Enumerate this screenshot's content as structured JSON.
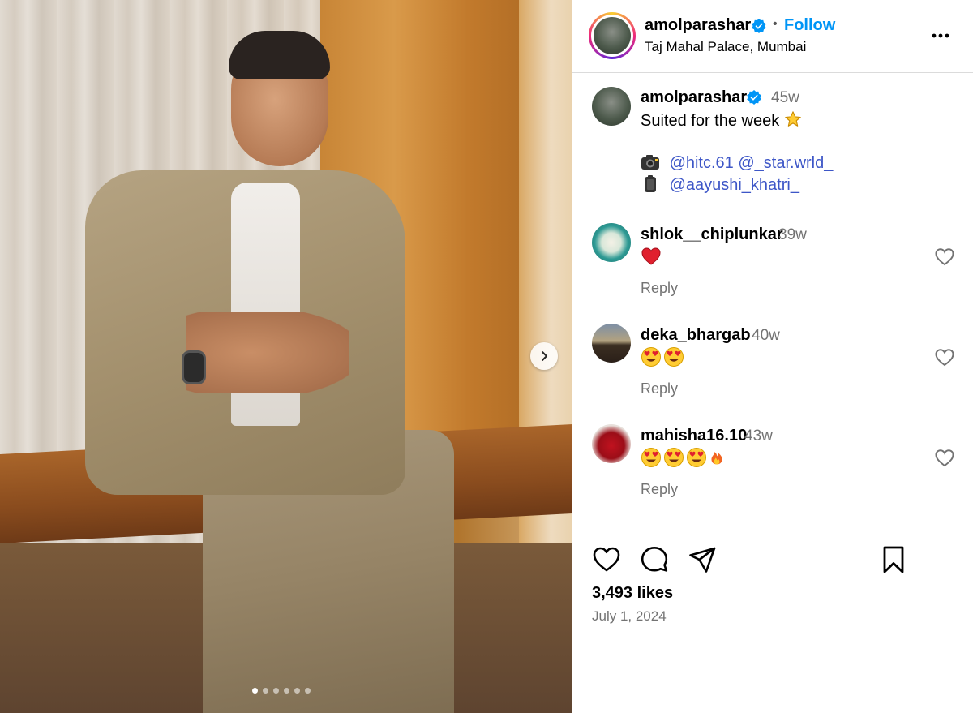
{
  "post": {
    "photo": {
      "carousel_dots": 6,
      "active_dot": 0
    },
    "header": {
      "username": "amolparashar",
      "separator": "•",
      "follow_label": "Follow",
      "location": "Taj Mahal Palace, Mumbai"
    },
    "caption": {
      "username": "amolparashar",
      "time": "45w",
      "text": "Suited for the week",
      "line1_mention1": "@hitc.61",
      "line1_mention2": "@_star.wrld_",
      "line2_mention": "@aayushi_khatri_"
    },
    "comments": [
      {
        "username": "shlok__chiplunkar",
        "time": "39w",
        "emojis": [
          "red-heart"
        ],
        "reply_label": "Reply"
      },
      {
        "username": "deka_bhargab",
        "time": "40w",
        "emojis": [
          "heart-eyes",
          "heart-eyes"
        ],
        "reply_label": "Reply"
      },
      {
        "username": "mahisha16.10",
        "time": "43w",
        "emojis": [
          "heart-eyes",
          "heart-eyes",
          "heart-eyes",
          "fire"
        ],
        "reply_label": "Reply"
      }
    ],
    "actions": {
      "likes": "3,493 likes",
      "date": "July 1, 2024"
    },
    "colors": {
      "link_blue": "#0095f6",
      "mention_blue": "#3d56c7",
      "muted_gray": "#737373",
      "verified_blue": "#0095f6"
    }
  }
}
